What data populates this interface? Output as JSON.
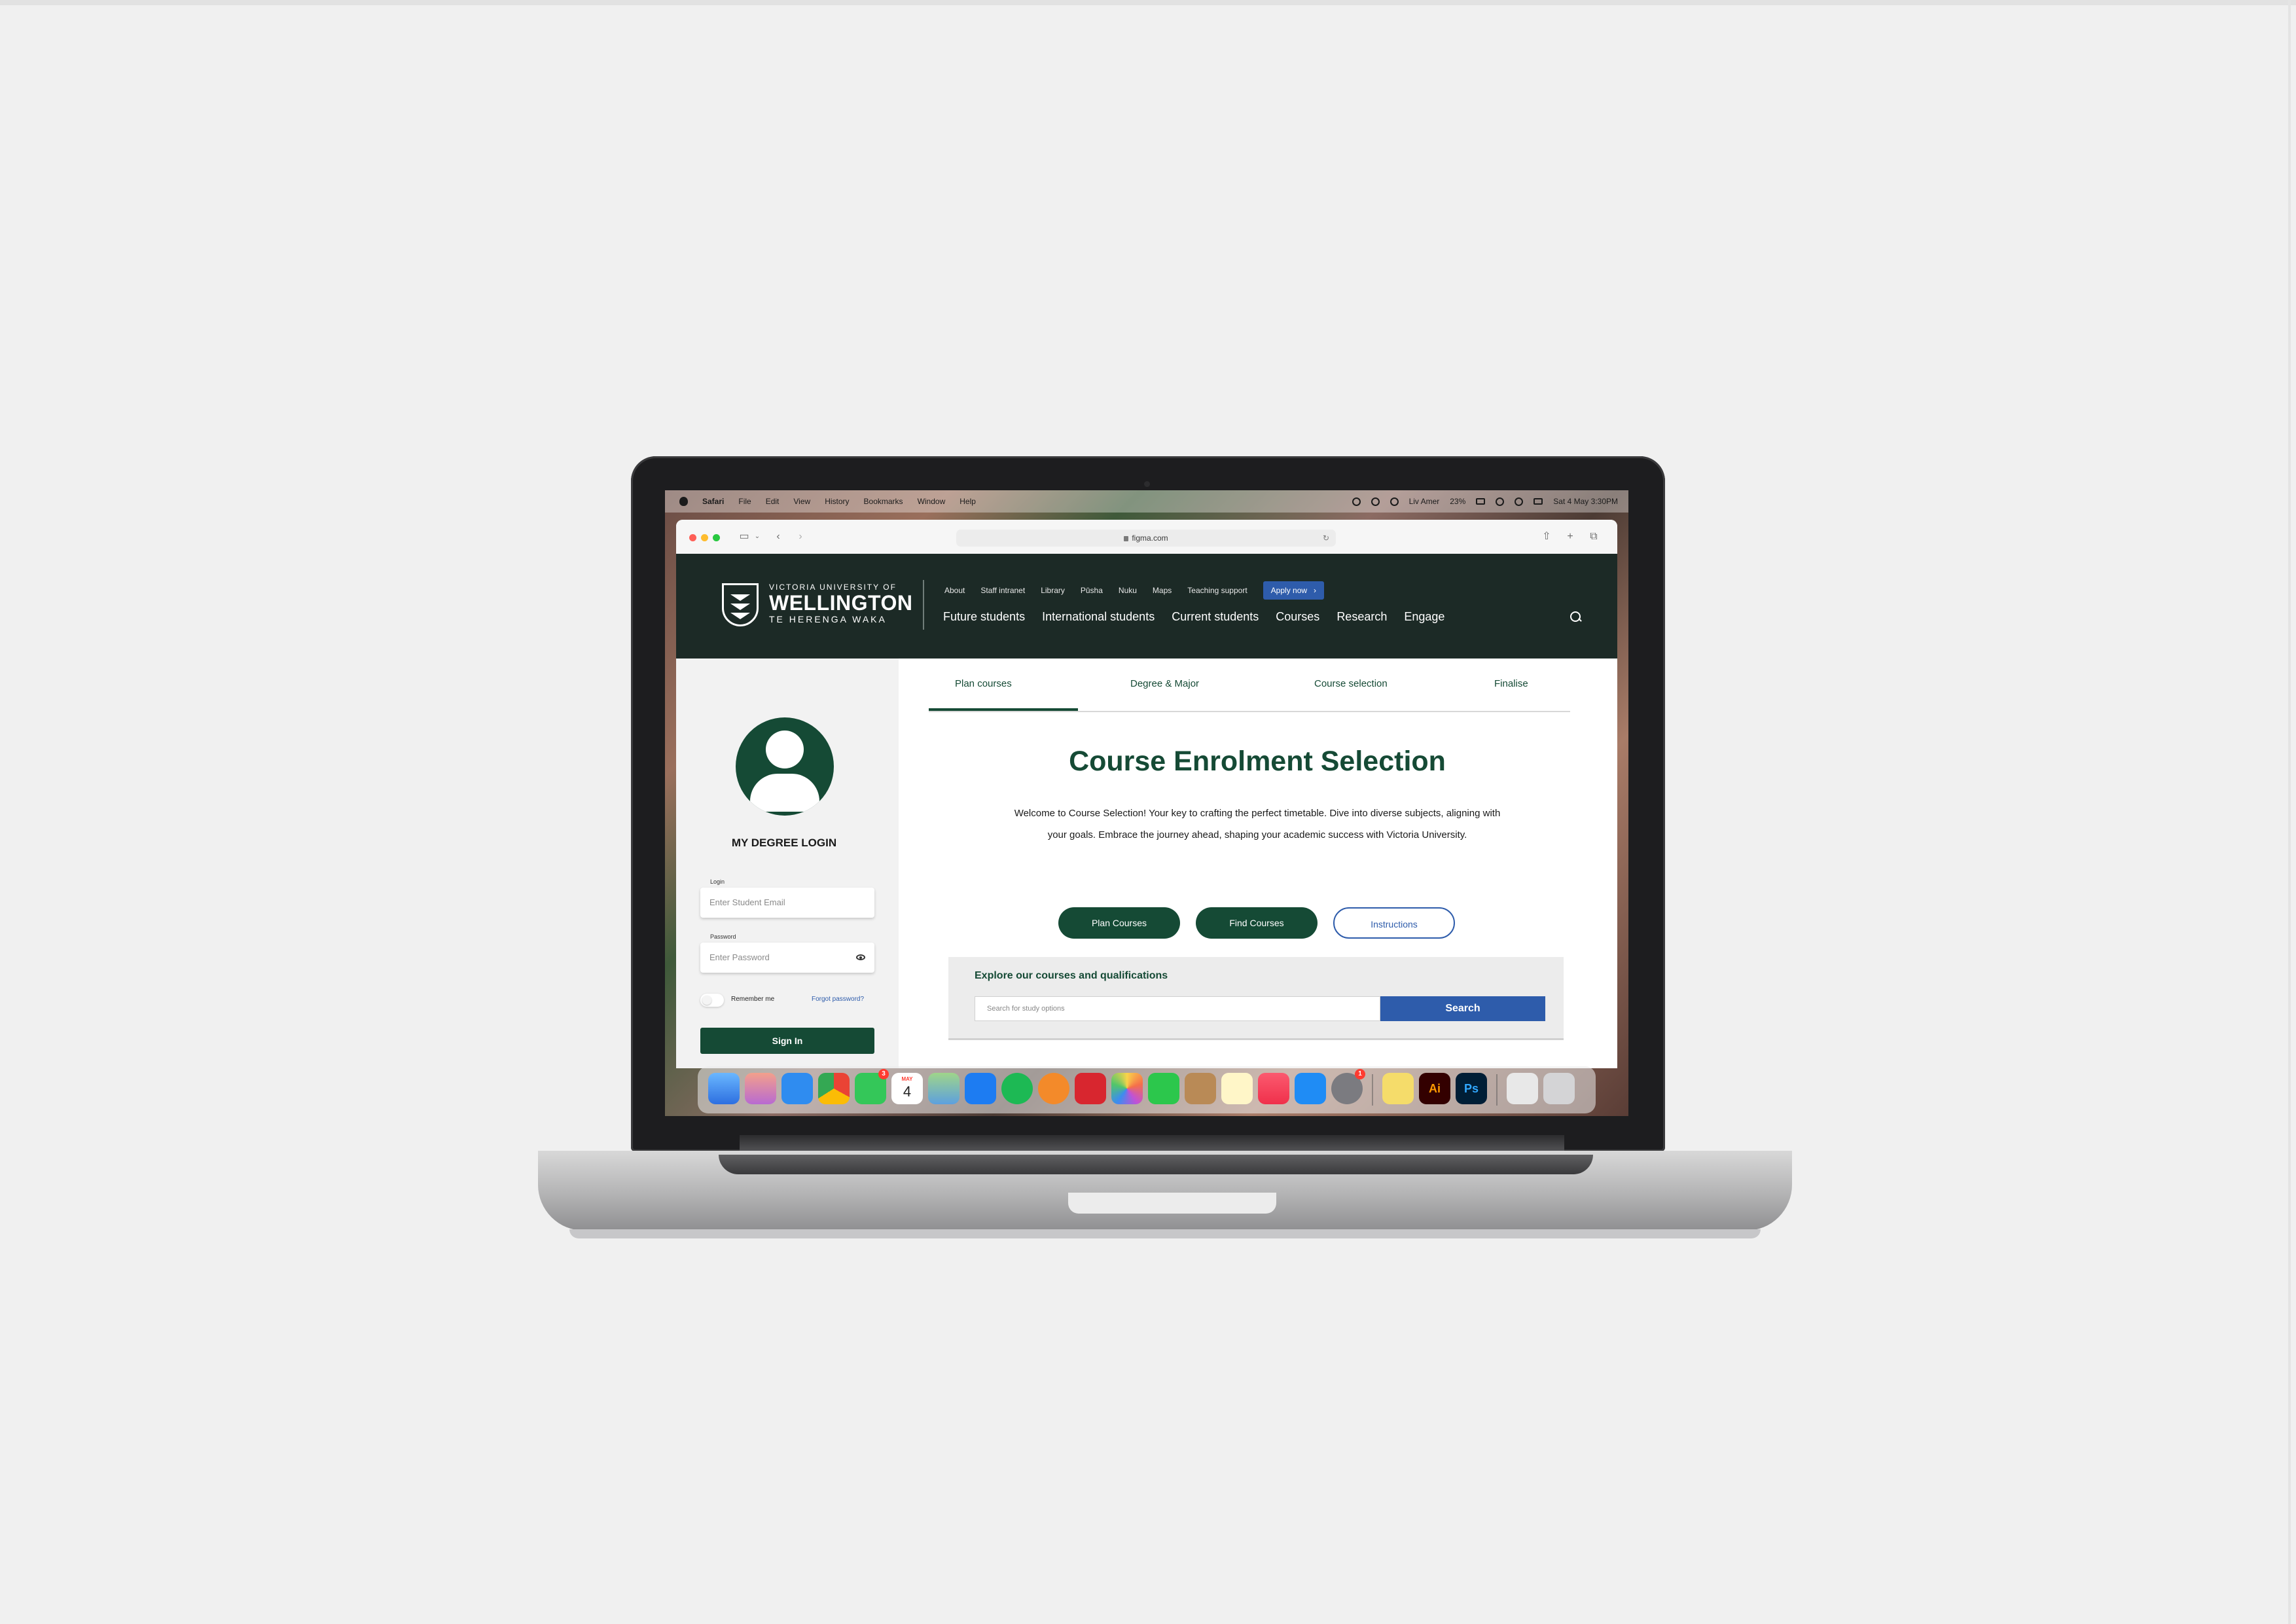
{
  "menubar": {
    "app": "Safari",
    "items": [
      "File",
      "Edit",
      "View",
      "History",
      "Bookmarks",
      "Window",
      "Help"
    ],
    "user": "Liv Amer",
    "battery": "23%",
    "datetime": "Sat 4 May  3:30PM"
  },
  "browser": {
    "url": "figma.com"
  },
  "site": {
    "logo": {
      "line1": "VICTORIA UNIVERSITY OF",
      "line2": "WELLINGTON",
      "line3": "TE HERENGA WAKA"
    },
    "utility_nav": [
      "About",
      "Staff intranet",
      "Library",
      "Pūsha",
      "Nuku",
      "Maps",
      "Teaching support"
    ],
    "apply_label": "Apply now",
    "main_nav": [
      "Future students",
      "International students",
      "Current students",
      "Courses",
      "Research",
      "Engage"
    ]
  },
  "login": {
    "title": "MY DEGREE LOGIN",
    "login_label": "Login",
    "email_placeholder": "Enter Student Email",
    "password_label": "Password",
    "password_placeholder": "Enter Password",
    "remember_label": "Remember me",
    "forgot_label": "Forgot password?",
    "signin_label": "Sign In"
  },
  "tabs": [
    "Plan courses",
    "Degree & Major",
    "Course selection",
    "Finalise"
  ],
  "main": {
    "title": "Course Enrolment Selection",
    "description": "Welcome to Course Selection! Your key to crafting the perfect timetable. Dive into diverse subjects, aligning with your goals. Embrace the journey ahead, shaping your academic success with Victoria University.",
    "buttons": [
      "Plan Courses",
      "Find Courses",
      "Instructions"
    ]
  },
  "explore": {
    "title": "Explore our courses and qualifications",
    "placeholder": "Search for study options",
    "search_label": "Search"
  },
  "dock": {
    "calendar_month": "MAY",
    "calendar_day": "4",
    "messages_badge": "3",
    "settings_badge": "1",
    "ai_label": "Ai",
    "ps_label": "Ps"
  },
  "colors": {
    "brand_green": "#154a35",
    "header_dark": "#1c2a26",
    "link_blue": "#2e5cab",
    "page_bg": "#f0f0f0"
  }
}
